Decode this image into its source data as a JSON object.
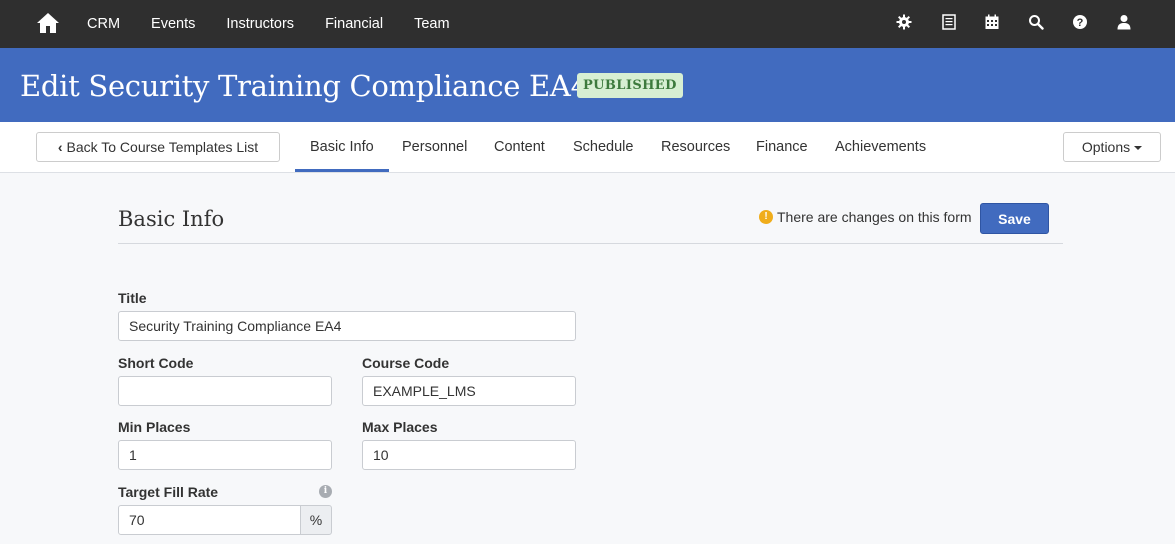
{
  "topnav": {
    "home_icon": "home-icon",
    "links": [
      "CRM",
      "Events",
      "Instructors",
      "Financial",
      "Team"
    ],
    "icons": [
      "gear-icon",
      "list-icon",
      "calendar-icon",
      "search-icon",
      "help-icon",
      "user-icon"
    ]
  },
  "header": {
    "title": "Edit Security Training Compliance EA4",
    "status_badge": "PUBLISHED",
    "accent_color": "#416bbf"
  },
  "tabbar": {
    "back_label": "Back To Course Templates List",
    "tabs": [
      "Basic Info",
      "Personnel",
      "Content",
      "Schedule",
      "Resources",
      "Finance",
      "Achievements"
    ],
    "active_tab": "Basic Info",
    "options_label": "Options"
  },
  "form": {
    "section_title": "Basic Info",
    "changes_notice": "There are changes on this form",
    "save_label": "Save",
    "title_label": "Title",
    "title_value": "Security Training Compliance EA4",
    "short_code_label": "Short Code",
    "short_code_value": "",
    "course_code_label": "Course Code",
    "course_code_value": "EXAMPLE_LMS",
    "min_places_label": "Min Places",
    "min_places_value": "1",
    "max_places_label": "Max Places",
    "max_places_value": "10",
    "fill_rate_label": "Target Fill Rate",
    "fill_rate_value": "70",
    "fill_rate_unit": "%"
  }
}
